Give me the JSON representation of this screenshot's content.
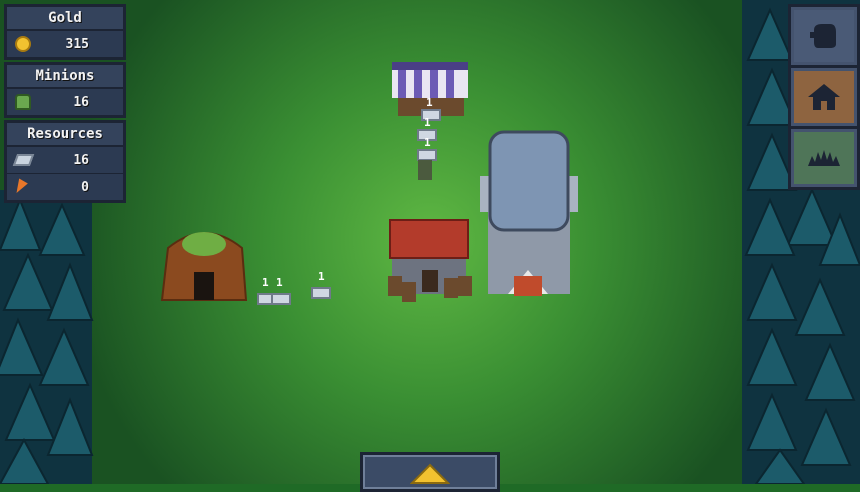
{
  "hud": {
    "gold": {
      "title": "Gold",
      "value": "315",
      "icon": "coin-icon"
    },
    "minions": {
      "title": "Minions",
      "value": "16",
      "icon": "minion-icon"
    },
    "resources": {
      "title": "Resources",
      "items": [
        {
          "icon": "metal-ingot-icon",
          "value": "16"
        },
        {
          "icon": "carrot-icon",
          "value": "0"
        }
      ]
    }
  },
  "tools": [
    {
      "name": "minion-head-icon",
      "active": false
    },
    {
      "name": "house-icon",
      "active": true
    },
    {
      "name": "hedgehog-icon",
      "active": false
    }
  ],
  "expand_button": {
    "icon": "triangle-up-icon",
    "color": "#f2c230"
  },
  "world_labels": [
    "1",
    "1",
    "1",
    "1",
    "1",
    "1"
  ],
  "colors": {
    "grass": "#1f6a26",
    "grass_light": "#4ca33c",
    "forest": "#123c4a",
    "panel": "#3b4b66",
    "panel_border": "#1c2434"
  }
}
